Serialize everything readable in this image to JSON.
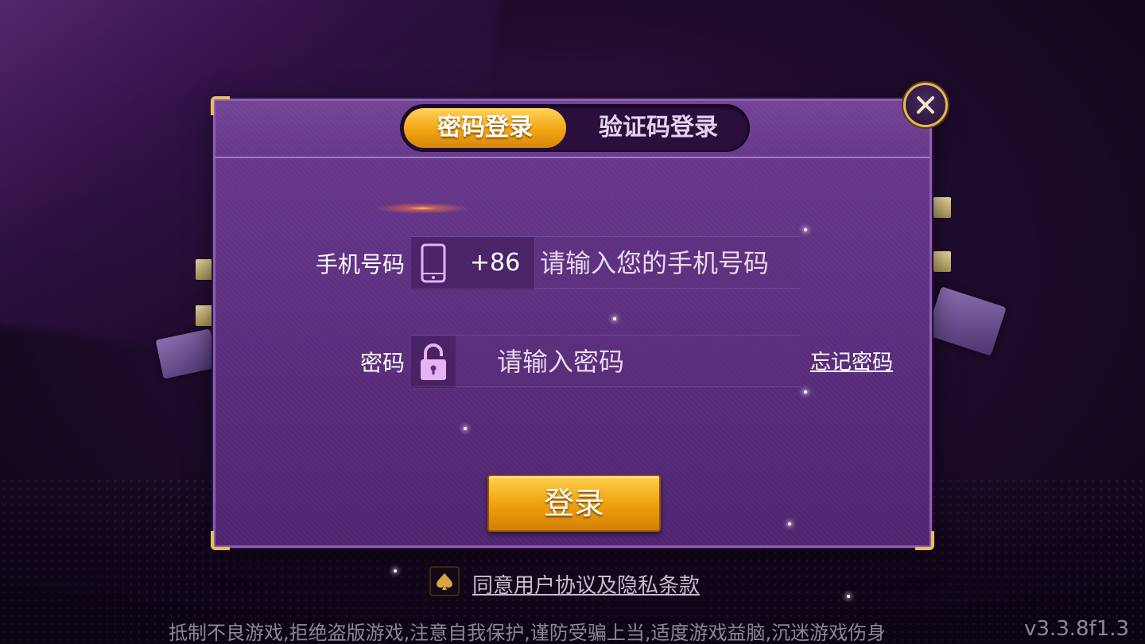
{
  "tabs": {
    "password_login": "密码登录",
    "code_login": "验证码登录",
    "active": "password_login"
  },
  "form": {
    "phone_label": "手机号码",
    "country_code": "+86",
    "phone_placeholder": "请输入您的手机号码",
    "phone_value": "",
    "password_label": "密码",
    "password_placeholder": "请输入密码",
    "password_value": "",
    "forgot_password": "忘记密码",
    "login_button": "登录"
  },
  "agreement": {
    "text": "同意用户协议及隐私条款",
    "icon": "spade-icon"
  },
  "footer": {
    "notice": "抵制不良游戏,拒绝盗版游戏,注意自我保护,谨防受骗上当,适度游戏益脑,沉迷游戏伤身",
    "version": "v3.3.8f1.3"
  },
  "colors": {
    "accent": "#f3a612",
    "panel": "#5c2e7e",
    "gold_border": "#e6bf63"
  }
}
